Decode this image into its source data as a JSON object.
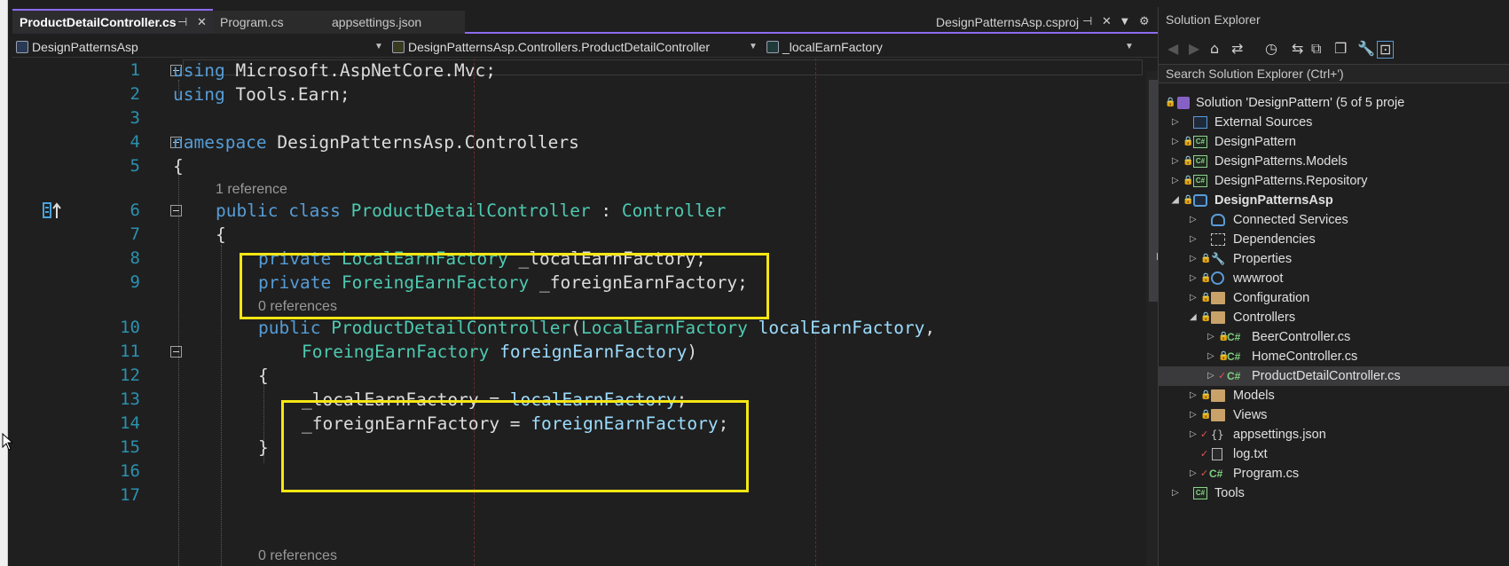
{
  "tabs": [
    {
      "label": "ProductDetailController.cs",
      "active": true
    },
    {
      "label": "Program.cs",
      "active": false
    },
    {
      "label": "appsettings.json",
      "active": false
    }
  ],
  "project_tab": {
    "label": "DesignPatternsAsp.csproj"
  },
  "navbar": {
    "project": "DesignPatternsAsp",
    "type": "DesignPatternsAsp.Controllers.ProductDetailController",
    "member": "_localEarnFactory"
  },
  "codelens": {
    "class_refs": "1 reference",
    "ctor_refs": "0 references",
    "next_refs": "0 references"
  },
  "line_numbers": [
    "1",
    "2",
    "3",
    "4",
    "5",
    "6",
    "7",
    "8",
    "9",
    "10",
    "11",
    "12",
    "13",
    "14",
    "15",
    "16",
    "17"
  ],
  "code": {
    "l1": [
      [
        "kw",
        "using"
      ],
      [
        "pl",
        " Microsoft.AspNetCore.Mvc;"
      ]
    ],
    "l2": [
      [
        "kw",
        "using"
      ],
      [
        "pl",
        " Tools.Earn;"
      ]
    ],
    "l4": [
      [
        "kw",
        "namespace"
      ],
      [
        "pl",
        " DesignPatternsAsp.Controllers"
      ]
    ],
    "l5": [
      [
        "pl",
        "{"
      ]
    ],
    "l6": [
      [
        "kw",
        "public"
      ],
      [
        "pl",
        " "
      ],
      [
        "kw",
        "class"
      ],
      [
        "pl",
        " "
      ],
      [
        "ty",
        "ProductDetailController"
      ],
      [
        "pl",
        " : "
      ],
      [
        "ty",
        "Controller"
      ]
    ],
    "l7": [
      [
        "pl",
        "{"
      ]
    ],
    "l8": [
      [
        "kw",
        "private"
      ],
      [
        "pl",
        " "
      ],
      [
        "ty",
        "LocalEarnFactory"
      ],
      [
        "pl",
        " _localEarnFactory;"
      ]
    ],
    "l9": [
      [
        "kw",
        "private"
      ],
      [
        "pl",
        " "
      ],
      [
        "ty",
        "ForeingEarnFactory"
      ],
      [
        "pl",
        " _foreignEarnFactory;"
      ]
    ],
    "l10": [
      [
        "kw",
        "public"
      ],
      [
        "pl",
        " "
      ],
      [
        "ty",
        "ProductDetailController"
      ],
      [
        "pl",
        "("
      ],
      [
        "ty",
        "LocalEarnFactory"
      ],
      [
        "pl",
        " "
      ],
      [
        "id",
        "localEarnFactory"
      ],
      [
        "pl",
        ","
      ]
    ],
    "l11": [
      [
        "ty",
        "ForeingEarnFactory"
      ],
      [
        "pl",
        " "
      ],
      [
        "id",
        "foreignEarnFactory"
      ],
      [
        "pl",
        ")"
      ]
    ],
    "l12": [
      [
        "pl",
        "{"
      ]
    ],
    "l13": [
      [
        "pl",
        "_localEarnFactory = "
      ],
      [
        "id",
        "localEarnFactory"
      ],
      [
        "pl",
        ";"
      ]
    ],
    "l14": [
      [
        "pl",
        "_foreignEarnFactory = "
      ],
      [
        "id",
        "foreignEarnFactory"
      ],
      [
        "pl",
        ";"
      ]
    ],
    "l15": [
      [
        "pl",
        "}"
      ]
    ]
  },
  "solution_explorer": {
    "title": "Solution Explorer",
    "search_placeholder": "Search Solution Explorer (Ctrl+')",
    "items": [
      {
        "label": "Solution 'DesignPattern' (5 of 5 proje",
        "icon": "solution-icon"
      },
      {
        "label": "External Sources",
        "icon": "external-sources-icon"
      },
      {
        "label": "DesignPattern",
        "icon": "csharp-project-icon"
      },
      {
        "label": "DesignPatterns.Models",
        "icon": "csharp-project-icon"
      },
      {
        "label": "DesignPatterns.Repository",
        "icon": "csharp-project-icon"
      },
      {
        "label": "DesignPatternsAsp",
        "icon": "web-project-icon"
      },
      {
        "label": "Connected Services",
        "icon": "connected-services-icon"
      },
      {
        "label": "Dependencies",
        "icon": "dependencies-icon"
      },
      {
        "label": "Properties",
        "icon": "properties-icon"
      },
      {
        "label": "wwwroot",
        "icon": "globe-icon"
      },
      {
        "label": "Configuration",
        "icon": "folder-icon"
      },
      {
        "label": "Controllers",
        "icon": "folder-icon"
      },
      {
        "label": "BeerController.cs",
        "icon": "csharp-file-icon"
      },
      {
        "label": "HomeController.cs",
        "icon": "csharp-file-icon"
      },
      {
        "label": "ProductDetailController.cs",
        "icon": "csharp-file-icon"
      },
      {
        "label": "Models",
        "icon": "folder-icon"
      },
      {
        "label": "Views",
        "icon": "folder-icon"
      },
      {
        "label": "appsettings.json",
        "icon": "json-file-icon"
      },
      {
        "label": "log.txt",
        "icon": "text-file-icon"
      },
      {
        "label": "Program.cs",
        "icon": "csharp-file-icon"
      },
      {
        "label": "Tools",
        "icon": "csharp-project-icon"
      }
    ]
  },
  "colors": {
    "keyword": "#569cd6",
    "type": "#4ec9b0",
    "identifier": "#9cdcfe",
    "highlight_box": "#f5e614",
    "accent": "#8b6cf0"
  }
}
